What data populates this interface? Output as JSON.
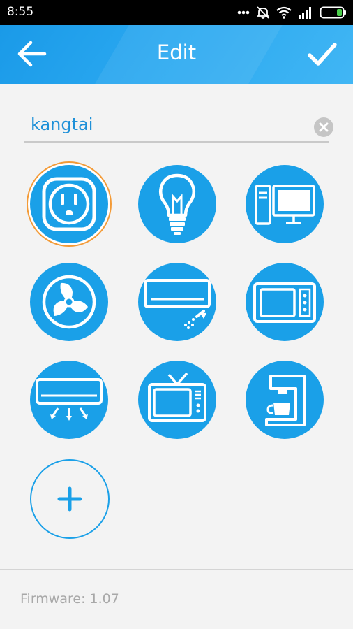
{
  "status_bar": {
    "time": "8:55",
    "icons": [
      "dots-icon",
      "mute-icon",
      "wifi-icon",
      "signal-icon",
      "battery-icon"
    ]
  },
  "app_bar": {
    "title": "Edit",
    "back_icon": "arrow-left-icon",
    "confirm_icon": "checkmark-icon"
  },
  "name_field": {
    "value": "kangtai",
    "clear_icon": "clear-icon"
  },
  "device_icons": [
    {
      "name": "outlet-icon",
      "selected": true
    },
    {
      "name": "light-bulb-icon",
      "selected": false
    },
    {
      "name": "computer-icon",
      "selected": false
    },
    {
      "name": "fan-icon",
      "selected": false
    },
    {
      "name": "air-conditioner-icon",
      "selected": false
    },
    {
      "name": "microwave-icon",
      "selected": false
    },
    {
      "name": "air-conditioner-cooling-icon",
      "selected": false
    },
    {
      "name": "tv-icon",
      "selected": false
    },
    {
      "name": "coffee-maker-icon",
      "selected": false
    }
  ],
  "add_button": {
    "icon": "plus-icon"
  },
  "footer": {
    "firmware": "Firmware: 1.07"
  },
  "colors": {
    "accent": "#1aa0e8",
    "selection_ring": "#f39a36",
    "text_value": "#1e90d8",
    "footer_text": "#a8a8a8"
  }
}
